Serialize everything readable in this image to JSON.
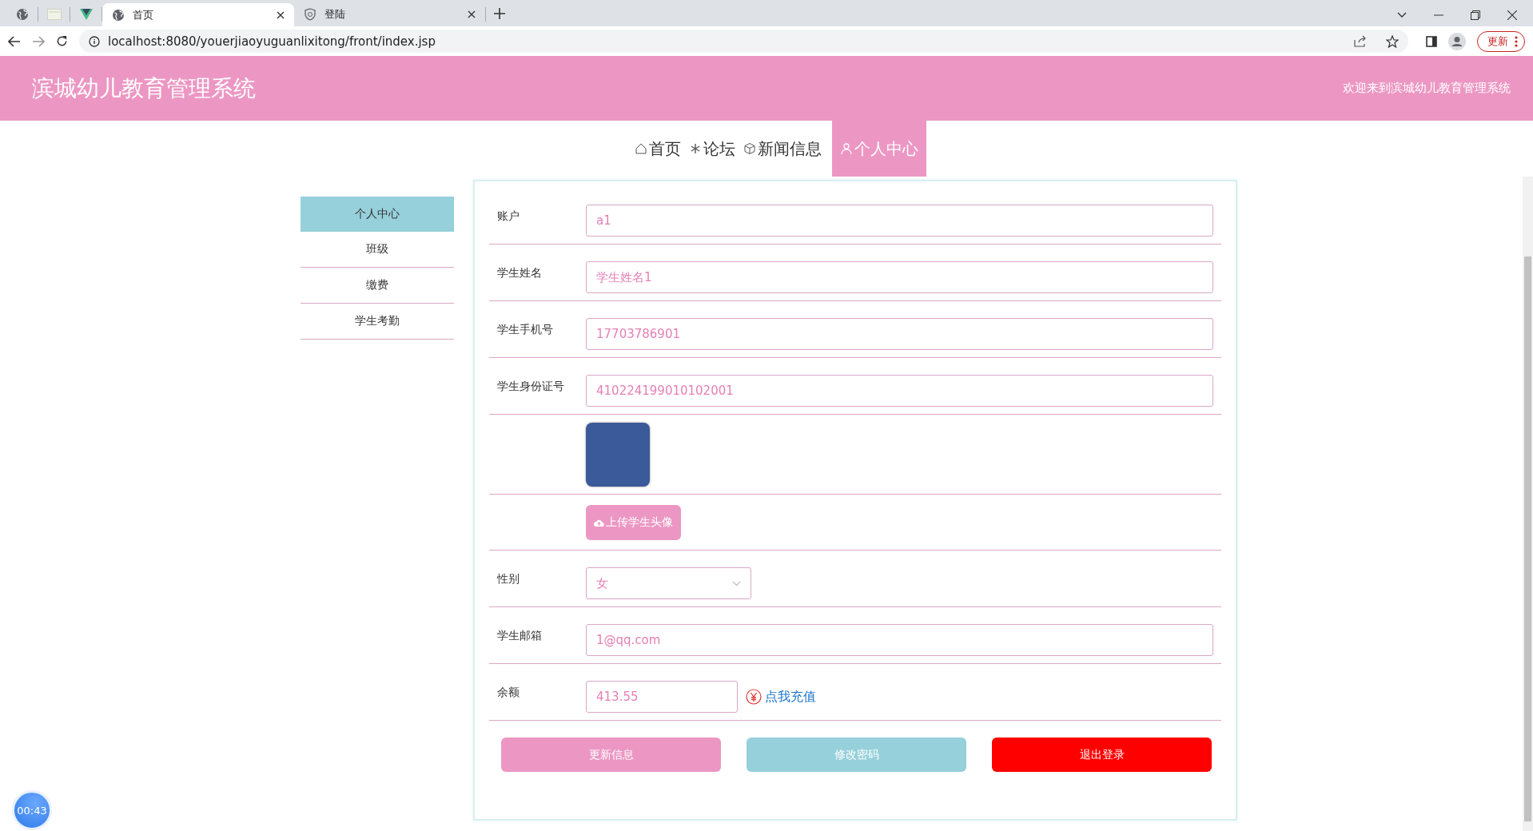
{
  "browser": {
    "tabs": [
      {
        "kind": "icon",
        "selected": false
      },
      {
        "kind": "icon",
        "selected": false
      },
      {
        "kind": "icon",
        "selected": false
      },
      {
        "kind": "labeled",
        "label": "首页",
        "selected": true
      },
      {
        "kind": "labeled",
        "label": "登陆",
        "selected": false
      }
    ],
    "address": "localhost:8080/youerjiaoyuguanlixitong/front/index.jsp",
    "update_button": "更新"
  },
  "header": {
    "title": "滨城幼儿教育管理系统",
    "welcome": "欢迎来到滨城幼儿教育管理系统"
  },
  "nav": [
    {
      "label": "首页",
      "selected": false
    },
    {
      "label": "论坛",
      "selected": false
    },
    {
      "label": "新闻信息",
      "selected": false
    },
    {
      "label": "个人中心",
      "selected": true
    }
  ],
  "sidebar": {
    "items": [
      {
        "label": "个人中心",
        "selected": true
      },
      {
        "label": "班级",
        "selected": false
      },
      {
        "label": "缴费",
        "selected": false
      },
      {
        "label": "学生考勤",
        "selected": false
      }
    ]
  },
  "form": {
    "rows": [
      {
        "kind": "text",
        "label": "账户",
        "value": "a1"
      },
      {
        "kind": "text",
        "label": "学生姓名",
        "value": "学生姓名1"
      },
      {
        "kind": "text",
        "label": "学生手机号",
        "value": "17703786901"
      },
      {
        "kind": "text",
        "label": "学生身份证号",
        "value": "410224199010102001"
      },
      {
        "kind": "avatar"
      },
      {
        "kind": "upload",
        "button": "上传学生头像"
      },
      {
        "kind": "select",
        "label": "性别",
        "value": "女"
      },
      {
        "kind": "text",
        "label": "学生邮箱",
        "value": "1@qq.com"
      },
      {
        "kind": "balance",
        "label": "余额",
        "value": "413.55",
        "link": "点我充值"
      }
    ],
    "buttons": [
      {
        "kind": "primary",
        "label": "更新信息"
      },
      {
        "kind": "secondary",
        "label": "修改密码"
      },
      {
        "kind": "danger",
        "label": "退出登录"
      }
    ]
  },
  "timer": "00:43"
}
